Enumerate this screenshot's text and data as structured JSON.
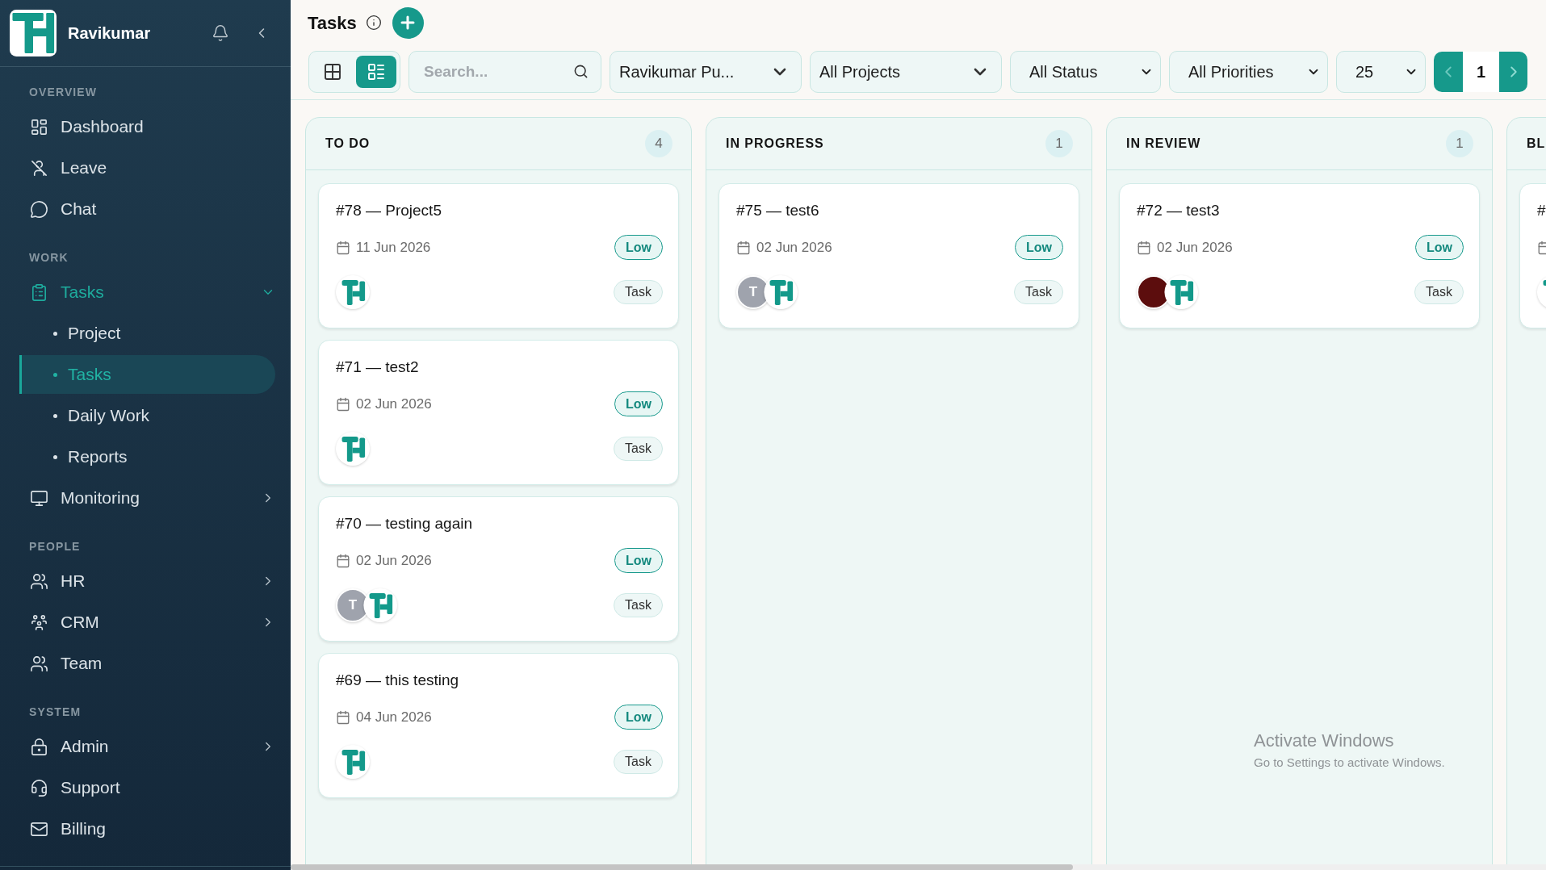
{
  "sidebar": {
    "brand": {
      "name": "Ravikumar"
    },
    "sections": [
      {
        "label": "OVERVIEW",
        "items": [
          {
            "label": "Dashboard",
            "selected": false
          },
          {
            "label": "Leave",
            "selected": false
          },
          {
            "label": "Chat",
            "selected": false
          }
        ]
      },
      {
        "label": "WORK",
        "items": [
          {
            "label": "Tasks",
            "selected": true,
            "expanded": true,
            "children": [
              {
                "label": "Project",
                "selected": false
              },
              {
                "label": "Tasks",
                "selected": true
              },
              {
                "label": "Daily Work",
                "selected": false
              },
              {
                "label": "Reports",
                "selected": false
              }
            ]
          },
          {
            "label": "Monitoring",
            "selected": false,
            "expanded": false
          }
        ]
      },
      {
        "label": "PEOPLE",
        "items": [
          {
            "label": "HR",
            "selected": false,
            "expanded": false
          },
          {
            "label": "CRM",
            "selected": false,
            "expanded": false
          },
          {
            "label": "Team",
            "selected": false
          }
        ]
      },
      {
        "label": "SYSTEM",
        "items": [
          {
            "label": "Admin",
            "selected": false,
            "expanded": false
          },
          {
            "label": "Support",
            "selected": false
          },
          {
            "label": "Billing",
            "selected": false
          }
        ]
      }
    ]
  },
  "header": {
    "title": "Tasks"
  },
  "toolbar": {
    "view_toggle": [
      {
        "selected": false
      },
      {
        "selected": true
      }
    ],
    "search": {
      "placeholder": "Search..."
    },
    "filters": [
      {
        "kind": "dropdown",
        "value": "Ravikumar Pu..."
      },
      {
        "kind": "dropdown",
        "value": "All Projects"
      },
      {
        "kind": "select",
        "value": "All Status"
      },
      {
        "kind": "select",
        "value": "All Priorities"
      },
      {
        "kind": "select",
        "value": "25"
      }
    ],
    "pagination": {
      "page": "1"
    }
  },
  "board": {
    "columns": [
      {
        "title": "TO DO",
        "count": "4",
        "cards": [
          {
            "title": "#78 — Project5",
            "date": "11 Jun 2026",
            "priority": "Low",
            "type": "Task",
            "avatars": [
              {
                "kind": "logo"
              }
            ]
          },
          {
            "title": "#71 — test2",
            "date": "02 Jun 2026",
            "priority": "Low",
            "type": "Task",
            "avatars": [
              {
                "kind": "logo"
              }
            ]
          },
          {
            "title": "#70 — testing again",
            "date": "02 Jun 2026",
            "priority": "Low",
            "type": "Task",
            "avatars": [
              {
                "kind": "initial",
                "text": "T"
              },
              {
                "kind": "logo"
              }
            ]
          },
          {
            "title": "#69 — this testing",
            "date": "04 Jun 2026",
            "priority": "Low",
            "type": "Task",
            "avatars": [
              {
                "kind": "logo"
              }
            ]
          }
        ]
      },
      {
        "title": "IN PROGRESS",
        "count": "1",
        "cards": [
          {
            "title": "#75 — test6",
            "date": "02 Jun 2026",
            "priority": "Low",
            "type": "Task",
            "avatars": [
              {
                "kind": "initial",
                "text": "T"
              },
              {
                "kind": "logo"
              }
            ]
          }
        ]
      },
      {
        "title": "IN REVIEW",
        "count": "1",
        "cards": [
          {
            "title": "#72 — test3",
            "date": "02 Jun 2026",
            "priority": "Low",
            "type": "Task",
            "avatars": [
              {
                "kind": "photo"
              },
              {
                "kind": "logo"
              }
            ]
          }
        ]
      },
      {
        "title": "BL",
        "cards": [
          {
            "title": "#",
            "avatars": [
              {
                "kind": "logo"
              }
            ]
          }
        ]
      }
    ]
  },
  "windows_activation_notice": {
    "title": "Activate Windows",
    "text": "Go to Settings to activate Windows."
  }
}
